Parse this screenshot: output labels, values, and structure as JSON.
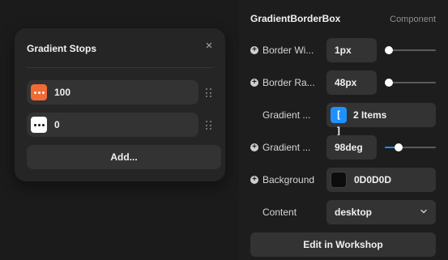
{
  "popover": {
    "title": "Gradient Stops",
    "close_glyph": "×",
    "stops": [
      {
        "value": "100",
        "color": "#f26a35",
        "dot_color": "#ffffff"
      },
      {
        "value": "0",
        "color": "#ffffff",
        "dot_color": "#111111"
      }
    ],
    "add_label": "Add..."
  },
  "panel": {
    "title": "GradientBorderBox",
    "type_label": "Component",
    "properties": {
      "border_width": {
        "label": "Border Wi...",
        "value": "1px",
        "slider_fraction": 0
      },
      "border_radius": {
        "label": "Border Ra...",
        "value": "48px",
        "slider_fraction": 0
      },
      "gradient_stops": {
        "label": "Gradient ...",
        "value": "2 Items",
        "icon": "[ ]"
      },
      "gradient_angle": {
        "label": "Gradient ...",
        "value": "98deg",
        "slider_fraction": 0.27
      },
      "background": {
        "label": "Background",
        "value": "0D0D0D",
        "swatch_color": "#0d0d0d"
      },
      "content": {
        "label": "Content",
        "value": "desktop"
      }
    },
    "workshop_label": "Edit in Workshop"
  },
  "colors": {
    "accent": "#1e90ff",
    "panel_bg": "#1d1d1d",
    "field_bg": "#333333"
  }
}
